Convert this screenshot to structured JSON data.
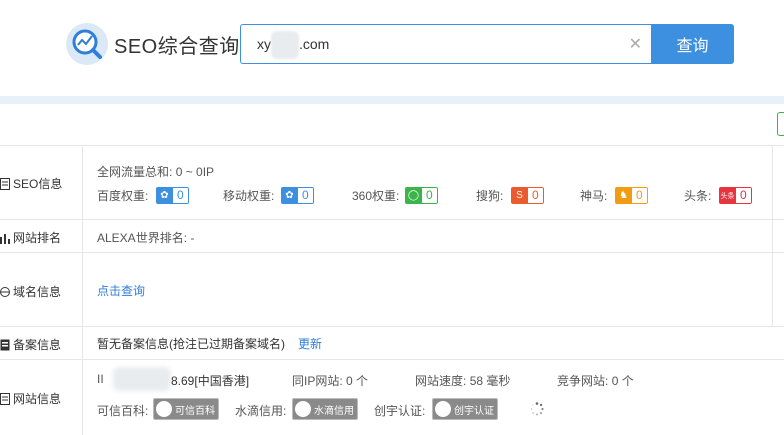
{
  "header": {
    "logo_text": "SEO综合查询",
    "search_value": "xy .com",
    "search_prefix": "xy",
    "search_suffix": ".com",
    "search_button": "查询"
  },
  "rows": {
    "seo": {
      "label": "SEO信息",
      "total_traffic_label": "全网流量总和:",
      "total_traffic_value": "0 ~ 0IP",
      "weights": [
        {
          "label": "百度权重:",
          "value": "0",
          "color": "#3d8fe0",
          "icon": "baidu-paw-icon",
          "glyph": "✿"
        },
        {
          "label": "移动权重:",
          "value": "0",
          "color": "#3d8fe0",
          "icon": "mobile-paw-icon",
          "glyph": "✿"
        },
        {
          "label": "360权重:",
          "value": "0",
          "color": "#3bb54a",
          "icon": "360-icon",
          "glyph": "◯"
        },
        {
          "label": "搜狗:",
          "value": "0",
          "color": "#ec5b2e",
          "icon": "sogou-icon",
          "glyph": "S"
        },
        {
          "label": "神马:",
          "value": "0",
          "color": "#f39c12",
          "icon": "shenma-icon",
          "glyph": "♞"
        },
        {
          "label": "头条:",
          "value": "0",
          "color": "#e7343f",
          "icon": "toutiao-icon",
          "glyph": "头条"
        }
      ]
    },
    "rank": {
      "label": "网站排名",
      "alexa_label": "ALEXA世界排名:",
      "alexa_value": "-"
    },
    "domain": {
      "label": "域名信息",
      "link": "点击查询"
    },
    "icp": {
      "label": "备案信息",
      "text": "暂无备案信息(抢注已过期备案域名)",
      "link": "更新"
    },
    "site": {
      "label": "网站信息",
      "ip_prefix": "II",
      "ip_suffix": "8.69[中国香港]",
      "same_ip_label": "同IP网站:",
      "same_ip_value": "0 个",
      "speed_label": "网站速度:",
      "speed_value": "58 毫秒",
      "competitor_label": "竞争网站:",
      "competitor_value": "0 个",
      "credits": [
        {
          "label": "可信百科:",
          "badge": "可信百科",
          "icon": "trusted-wiki-icon"
        },
        {
          "label": "水滴信用:",
          "badge": "水滴信用",
          "icon": "water-drop-icon"
        },
        {
          "label": "创宇认证:",
          "badge": "创宇认证",
          "icon": "chuangyu-cert-icon"
        }
      ]
    }
  },
  "colors": {
    "accent": "#3d8fe0",
    "link": "#2f7ed8",
    "band": "#e8f0f8"
  }
}
